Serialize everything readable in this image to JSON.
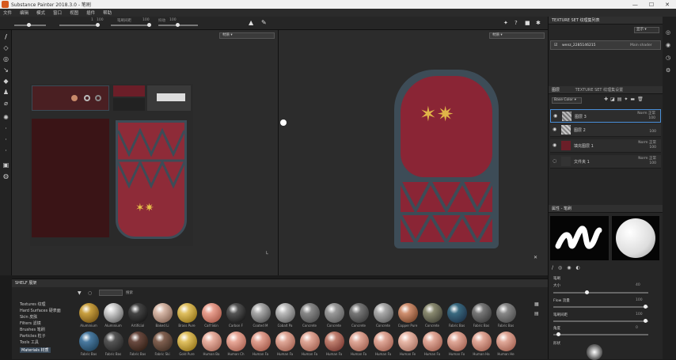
{
  "titlebar": {
    "title": "Substance Painter 2018.3.0 - 笔刷",
    "min": "—",
    "max": "☐",
    "close": "✕"
  },
  "menu": [
    "文件",
    "编辑",
    "模式",
    "窗口",
    "视图",
    "插件",
    "帮助"
  ],
  "toolprops": {
    "size_value": "1",
    "flow_value": "100",
    "stroke_label": "笔刷间距",
    "stroke_value": "100",
    "angle_label": "抖动",
    "jitter_value": "100"
  },
  "viewport2d": {
    "mode": "材质"
  },
  "viewport3d": {
    "mode": "材质"
  },
  "texture_set": {
    "header": "TEXTURE SET 纹理集列表",
    "selector": "显示",
    "item_name": "wenz_2285146215",
    "item_shader": "Main shader"
  },
  "layers": {
    "tab1": "图层",
    "tab2": "TEXTURE SET 纹理集设置",
    "channel": "Base Color",
    "items": [
      {
        "name": "图层 3",
        "blend": "Norm 正常",
        "opacity": "100"
      },
      {
        "name": "图层 2",
        "blend": "",
        "opacity": "100"
      },
      {
        "name": "填充图层 1",
        "blend": "Norm 正常",
        "opacity": "100"
      },
      {
        "name": "文件夹 1",
        "blend": "Norm 正常",
        "opacity": "100"
      }
    ]
  },
  "properties": {
    "header": "属性 - 笔刷",
    "section": "笔刷",
    "size_label": "大小",
    "size_value": "40",
    "flow_label": "Flow 流量",
    "flow_value": "100",
    "stroke_label": "笔刷间距",
    "stroke_value": "100",
    "angle_label": "角度",
    "angle_value": "0",
    "alpha_label": "形状"
  },
  "shelf": {
    "header": "SHELF 展架",
    "search_placeholder": "搜索",
    "categories": [
      "Textures 纹理",
      "Hard Surfaces 硬表面",
      "Skin 皮肤",
      "Filters 滤镜",
      "Brushes 笔刷",
      "Particles 粒子",
      "Tools 工具",
      "Materials 材质"
    ],
    "row1_labels": [
      "Aluminium",
      "Aluminium",
      "Artificial",
      "Baked Li",
      "Brass Pure",
      "Calf Skin",
      "Carbon F",
      "Coated M",
      "Cobalt Pa",
      "Concrete",
      "Concrete",
      "Concrete",
      "Concrete",
      "Copper Pure",
      "Concrete",
      "Fabric Bas",
      "Fabric Bas",
      "Fabric Bas"
    ],
    "row2_labels": [
      "Fabric Bas",
      "Fabric Bas",
      "Fabric Bas",
      "Fabric Ski",
      "Gold Pure",
      "Human Ba",
      "Human Ch",
      "Human Fa",
      "Human Fa",
      "Human Fa",
      "Human Fa",
      "Human Fa",
      "Human Fa",
      "Human Fe",
      "Human Fo",
      "Human Fo",
      "Human Ha",
      "Human He"
    ]
  },
  "colors": {
    "accent": "#4a90d9",
    "red": "#8b2530",
    "frame": "#3d4c57",
    "panel": "#262626"
  }
}
